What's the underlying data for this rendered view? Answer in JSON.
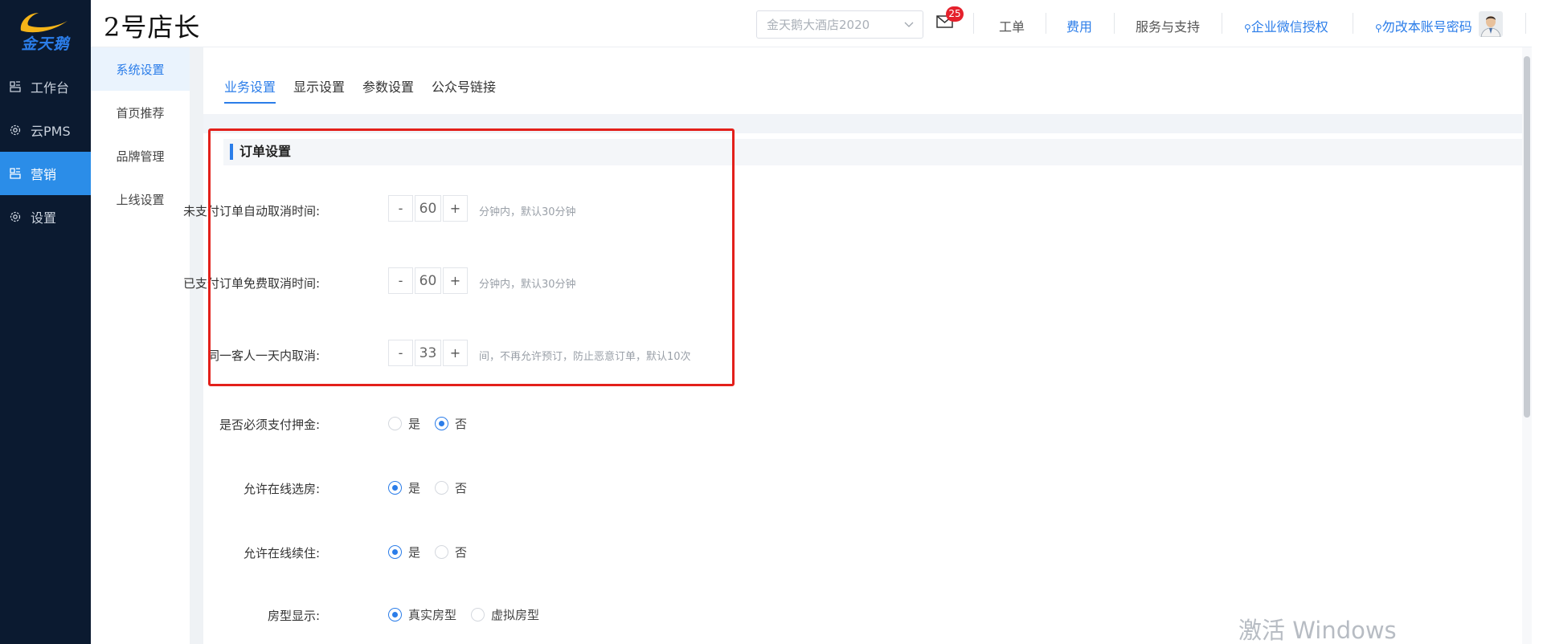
{
  "app": {
    "logo_text": "金天鹅",
    "brand_title": "2号店长"
  },
  "sidebar": {
    "items": [
      {
        "label": "工作台",
        "icon": "dashboard-icon",
        "active": false
      },
      {
        "label": "云PMS",
        "icon": "gear-icon",
        "active": false
      },
      {
        "label": "营销",
        "icon": "dashboard-icon",
        "active": true
      },
      {
        "label": "设置",
        "icon": "gear-icon",
        "active": false
      }
    ]
  },
  "header": {
    "store_select": "金天鹅大酒店2020",
    "mail_badge": "25",
    "links": [
      "工单",
      "费用",
      "服务与支持",
      "企业微信授权",
      "勿改本账号密码"
    ]
  },
  "submenu": {
    "items": [
      "系统设置",
      "首页推荐",
      "品牌管理",
      "上线设置"
    ]
  },
  "tabs": [
    "业务设置",
    "显示设置",
    "参数设置",
    "公众号链接"
  ],
  "order_section": {
    "title": "订单设置",
    "rows": [
      {
        "label": "未支付订单自动取消时间:",
        "value": "60",
        "hint": "分钟内，默认30分钟"
      },
      {
        "label": "已支付订单免费取消时间:",
        "value": "60",
        "hint": "分钟内，默认30分钟"
      },
      {
        "label": "同一客人一天内取消:",
        "value": "33",
        "hint": "间，不再允许预订，防止恶意订单，默认10次"
      }
    ],
    "minus": "-",
    "plus": "+"
  },
  "options": [
    {
      "label": "是否必须支付押金:",
      "choices": [
        "是",
        "否"
      ],
      "selected": 1
    },
    {
      "label": "允许在线选房:",
      "choices": [
        "是",
        "否"
      ],
      "selected": 0
    },
    {
      "label": "允许在线续住:",
      "choices": [
        "是",
        "否"
      ],
      "selected": 0
    },
    {
      "label": "房型显示:",
      "choices": [
        "真实房型",
        "虚拟房型"
      ],
      "selected": 0
    }
  ],
  "watermark": "激活 Windows",
  "colors": {
    "accent": "#2b7de9",
    "sidebar_bg": "#0b1a30",
    "highlight": "#e3201b",
    "badge": "#e5212c"
  }
}
